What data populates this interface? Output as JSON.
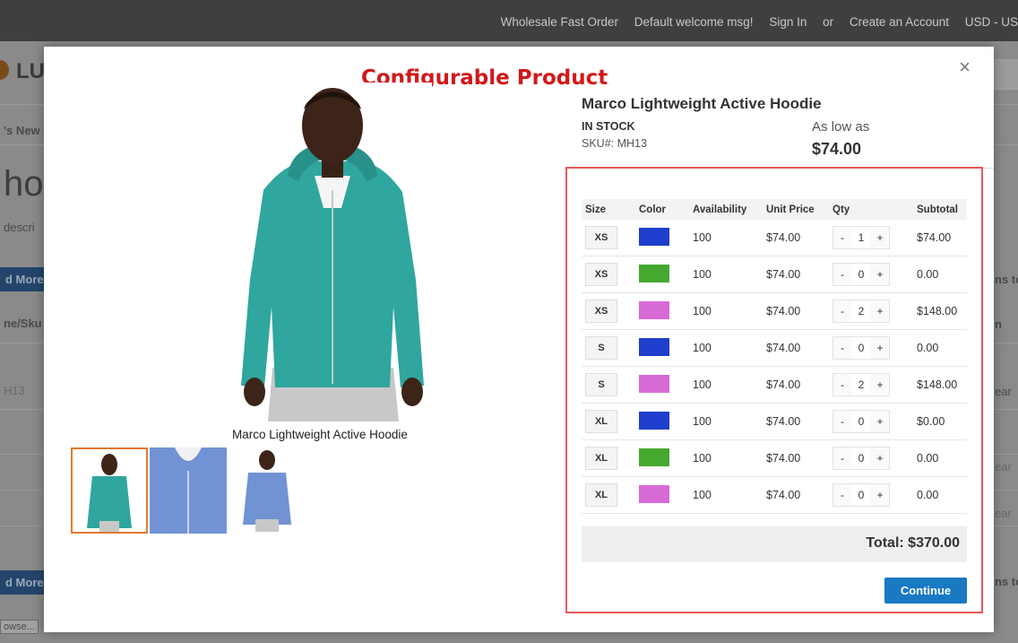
{
  "topbar": {
    "links": [
      "Wholesale Fast Order",
      "Default welcome msg!",
      "Sign In",
      "or",
      "Create an Account",
      "USD - US"
    ]
  },
  "background": {
    "logo": "LU",
    "nav": "'s New",
    "heading": "ho",
    "desc": "descri",
    "read_more": "d More",
    "col_name": "ne/Sku",
    "sku": "H13",
    "browse": "owse...",
    "right_a": "ns to",
    "right_b": "n",
    "clear_a": "ear",
    "clear_b": "ear",
    "clear_c": "ear",
    "read_more_2": "d More",
    "right_c": "ns to"
  },
  "modal": {
    "close_symbol": "×",
    "banner": "Configurable Product",
    "caption": "Marco Lightweight Active Hoodie",
    "product_name": "Marco Lightweight Active Hoodie",
    "stock": "IN STOCK",
    "sku": "SKU#:  MH13",
    "as_low_as": "As low as",
    "price": "$74.00",
    "columns": [
      "Size",
      "Color",
      "Availability",
      "Unit Price",
      "Qty",
      "Subtotal"
    ],
    "rows": [
      {
        "size": "XS",
        "color": "#1e3fcb",
        "availability": "100",
        "unit_price": "$74.00",
        "qty": "1",
        "subtotal": "$74.00"
      },
      {
        "size": "XS",
        "color": "#45a92f",
        "availability": "100",
        "unit_price": "$74.00",
        "qty": "0",
        "subtotal": "0.00"
      },
      {
        "size": "XS",
        "color": "#d86ad6",
        "availability": "100",
        "unit_price": "$74.00",
        "qty": "2",
        "subtotal": "$148.00"
      },
      {
        "size": "S",
        "color": "#1e3fcb",
        "availability": "100",
        "unit_price": "$74.00",
        "qty": "0",
        "subtotal": "0.00"
      },
      {
        "size": "S",
        "color": "#d86ad6",
        "availability": "100",
        "unit_price": "$74.00",
        "qty": "2",
        "subtotal": "$148.00"
      },
      {
        "size": "XL",
        "color": "#1e3fcb",
        "availability": "100",
        "unit_price": "$74.00",
        "qty": "0",
        "subtotal": "$0.00"
      },
      {
        "size": "XL",
        "color": "#45a92f",
        "availability": "100",
        "unit_price": "$74.00",
        "qty": "0",
        "subtotal": "0.00"
      },
      {
        "size": "XL",
        "color": "#d86ad6",
        "availability": "100",
        "unit_price": "$74.00",
        "qty": "0",
        "subtotal": "0.00"
      }
    ],
    "minus": "-",
    "plus": "+",
    "total": "Total: $370.00",
    "continue_label": "Continue"
  }
}
